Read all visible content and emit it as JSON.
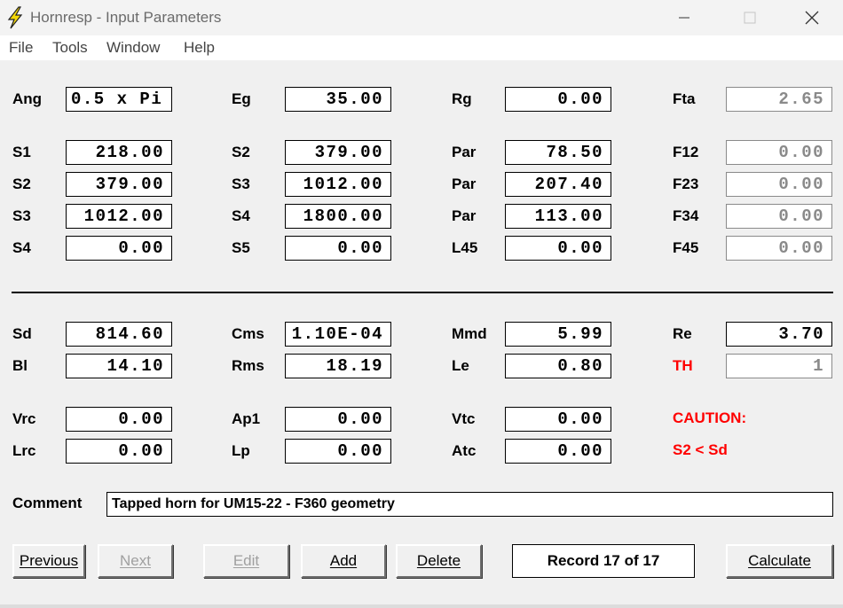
{
  "window": {
    "title": "Hornresp - Input Parameters"
  },
  "menu": [
    "File",
    "Tools",
    "Window",
    "Help"
  ],
  "fields": [
    {
      "label": "Ang",
      "value": "0.5 x Pi",
      "col": 0,
      "row": 0,
      "align": "left"
    },
    {
      "label": "Eg",
      "value": "35.00",
      "col": 1,
      "row": 0
    },
    {
      "label": "Rg",
      "value": "0.00",
      "col": 2,
      "row": 0
    },
    {
      "label": "Fta",
      "value": "2.65",
      "col": 3,
      "row": 0,
      "readonly": true
    },
    {
      "label": "S1",
      "value": "218.00",
      "col": 0,
      "row": 1
    },
    {
      "label": "S2",
      "value": "379.00",
      "col": 1,
      "row": 1
    },
    {
      "label": "Par",
      "value": "78.50",
      "col": 2,
      "row": 1
    },
    {
      "label": "F12",
      "value": "0.00",
      "col": 3,
      "row": 1,
      "readonly": true
    },
    {
      "label": "S2",
      "value": "379.00",
      "col": 0,
      "row": 2
    },
    {
      "label": "S3",
      "value": "1012.00",
      "col": 1,
      "row": 2
    },
    {
      "label": "Par",
      "value": "207.40",
      "col": 2,
      "row": 2
    },
    {
      "label": "F23",
      "value": "0.00",
      "col": 3,
      "row": 2,
      "readonly": true
    },
    {
      "label": "S3",
      "value": "1012.00",
      "col": 0,
      "row": 3
    },
    {
      "label": "S4",
      "value": "1800.00",
      "col": 1,
      "row": 3
    },
    {
      "label": "Par",
      "value": "113.00",
      "col": 2,
      "row": 3
    },
    {
      "label": "F34",
      "value": "0.00",
      "col": 3,
      "row": 3,
      "readonly": true
    },
    {
      "label": "S4",
      "value": "0.00",
      "col": 0,
      "row": 4
    },
    {
      "label": "S5",
      "value": "0.00",
      "col": 1,
      "row": 4
    },
    {
      "label": "L45",
      "value": "0.00",
      "col": 2,
      "row": 4
    },
    {
      "label": "F45",
      "value": "0.00",
      "col": 3,
      "row": 4,
      "readonly": true
    },
    {
      "label": "Sd",
      "value": "814.60",
      "col": 0,
      "row": 5
    },
    {
      "label": "Cms",
      "value": "1.10E-04",
      "col": 1,
      "row": 5
    },
    {
      "label": "Mmd",
      "value": "5.99",
      "col": 2,
      "row": 5
    },
    {
      "label": "Re",
      "value": "3.70",
      "col": 3,
      "row": 5
    },
    {
      "label": "Bl",
      "value": "14.10",
      "col": 0,
      "row": 6
    },
    {
      "label": "Rms",
      "value": "18.19",
      "col": 1,
      "row": 6
    },
    {
      "label": "Le",
      "value": "0.80",
      "col": 2,
      "row": 6
    },
    {
      "label": "TH",
      "value": "1",
      "col": 3,
      "row": 6,
      "readonly": true,
      "red_label": true
    },
    {
      "label": "Vrc",
      "value": "0.00",
      "col": 0,
      "row": 7
    },
    {
      "label": "Ap1",
      "value": "0.00",
      "col": 1,
      "row": 7
    },
    {
      "label": "Vtc",
      "value": "0.00",
      "col": 2,
      "row": 7
    },
    {
      "label": "Lrc",
      "value": "0.00",
      "col": 0,
      "row": 8
    },
    {
      "label": "Lp",
      "value": "0.00",
      "col": 1,
      "row": 8
    },
    {
      "label": "Atc",
      "value": "0.00",
      "col": 2,
      "row": 8
    }
  ],
  "caution": {
    "title": "CAUTION:",
    "message": "S2 < Sd"
  },
  "comment": {
    "label": "Comment",
    "value": "Tapped horn for UM15-22 - F360 geometry"
  },
  "buttons": {
    "previous": "Previous",
    "next": "Next",
    "edit": "Edit",
    "add": "Add",
    "delete": "Delete",
    "calculate": "Calculate"
  },
  "record_status": "Record 17 of 17",
  "colors": {
    "caution": "#ff0000",
    "readonly_text": "#8a8a8a",
    "window_bg": "#f0f0f0"
  }
}
